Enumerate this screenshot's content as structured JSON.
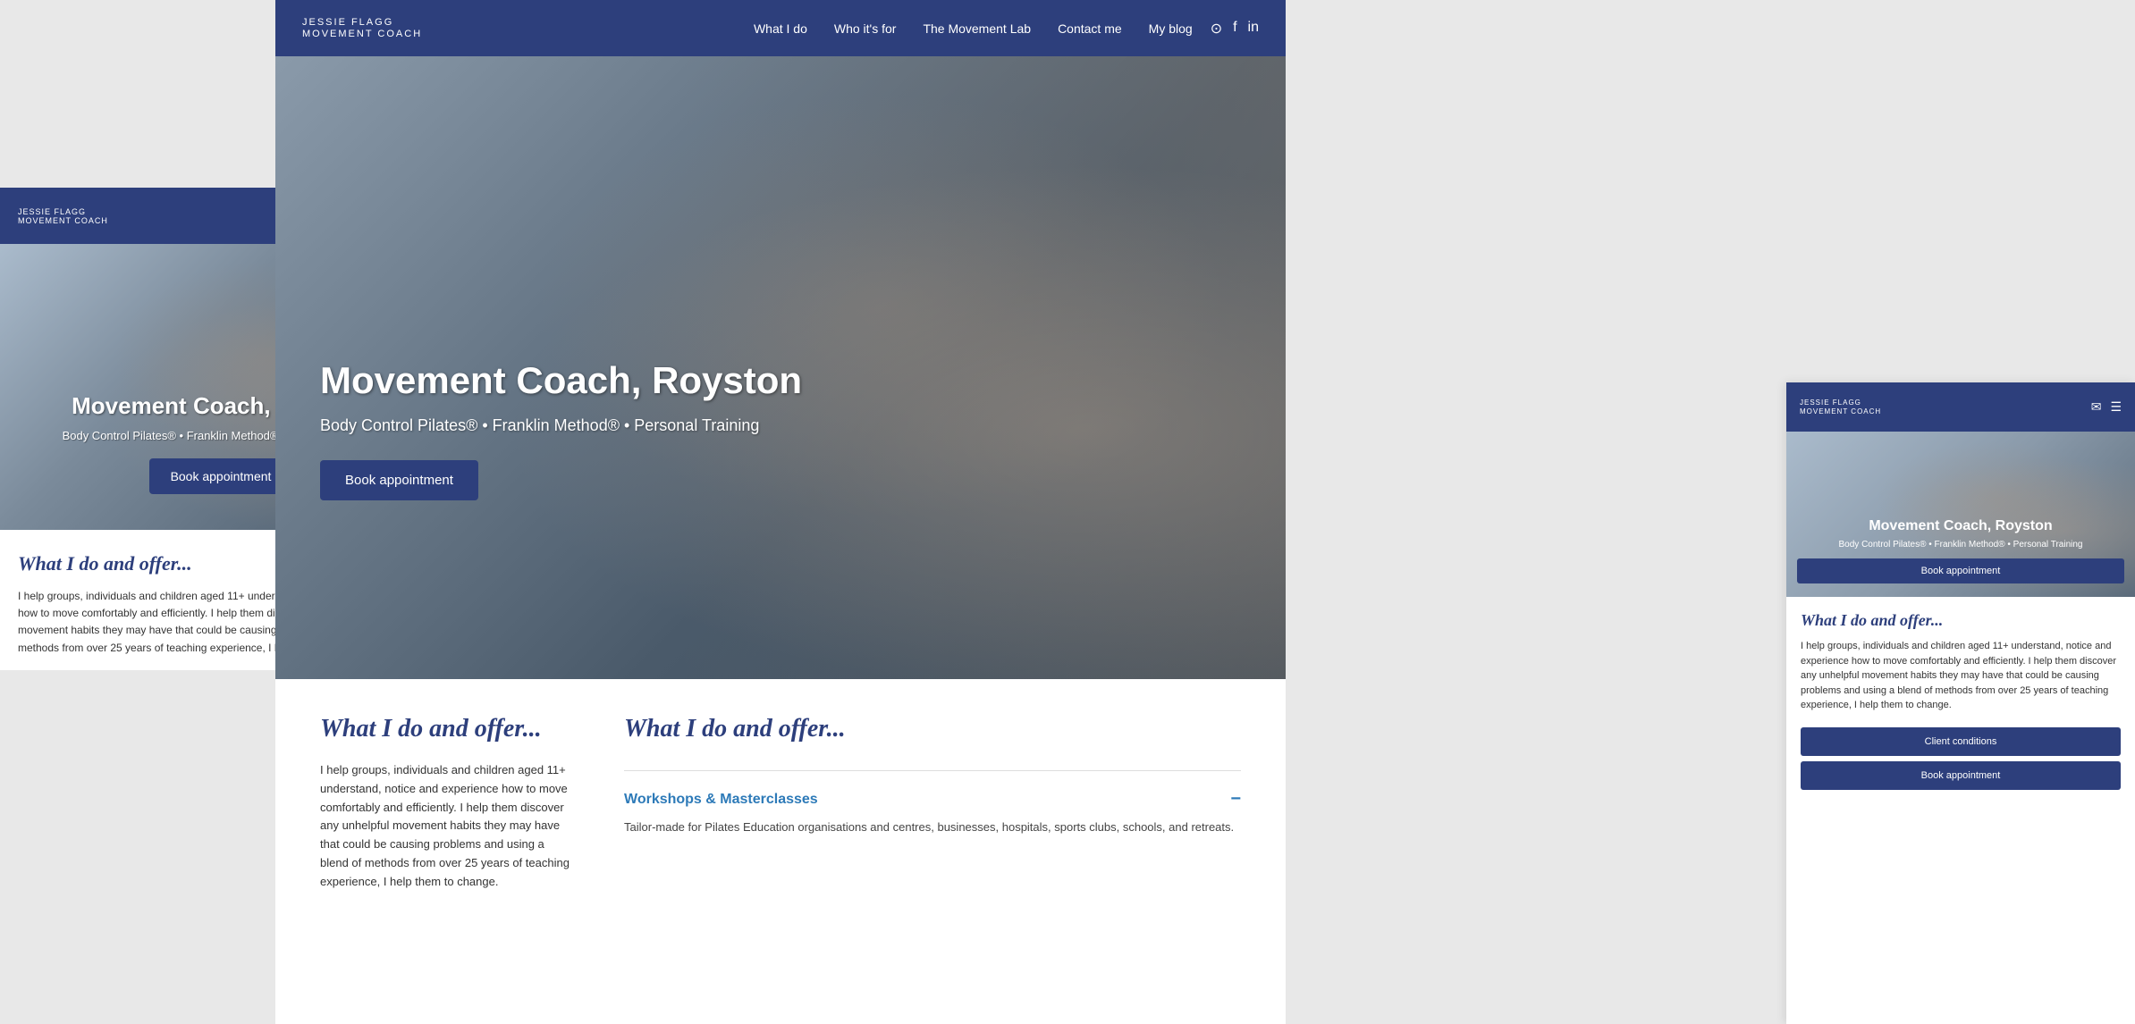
{
  "brand": {
    "name": "Movement Coach",
    "subtitle": "Jessie Flagg",
    "tagline": "Movement Coach"
  },
  "nav": {
    "links": [
      "What I do",
      "Who it's for",
      "The Movement Lab",
      "Contact me",
      "My blog"
    ],
    "social": [
      "instagram-icon",
      "facebook-icon",
      "linkedin-icon"
    ]
  },
  "hero": {
    "title": "Movement Coach, Royston",
    "subtitle": "Body Control Pilates® • Franklin Method® • Personal Training",
    "cta": "Book appointment"
  },
  "section": {
    "heading": "What I do and offer...",
    "body": "I help groups, individuals and children aged 11+ understand, notice and experience how to move comfortably and efficiently. I help them discover any unhelpful movement habits they may have that could be causing problems and using a blend of methods from over 25 years of teaching experience, I help them to change.",
    "workshop": {
      "title": "Workshops & Masterclasses",
      "description": "Tailor-made for Pilates Education organisations and centres, businesses, hospitals, sports clubs, schools, and retreats.",
      "collapse_icon": "minus-icon"
    }
  },
  "mobile_right": {
    "body_long": "I help groups, individuals and children aged 11+ understand, notice and experience how to move comfortably and efficiently. I help them discover any unhelpful movement habits they may have that could be causing problems and using a blend of methods from over 25 years of teaching experience, I help them to change.",
    "btn_client": "Client conditions",
    "btn_book": "Book appointment"
  }
}
